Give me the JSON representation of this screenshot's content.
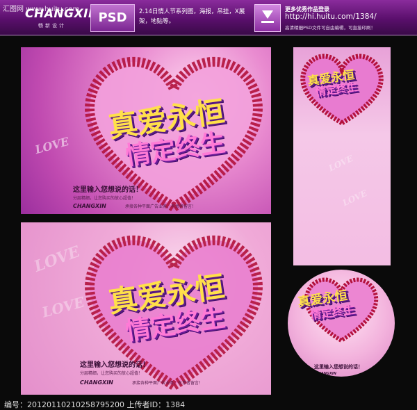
{
  "header": {
    "watermark": "汇图网 www.huitu.com",
    "logo": "CHANGXIN",
    "logo_sub": "畅新设计",
    "format": "PSD",
    "description": "2.14日情人节系列图，海报，吊挂，X展架，地贴等。",
    "more_label": "更多优秀作品登录",
    "url": "http://hi.huitu.com/1384/",
    "note": "高清精细PSD文件可自由编辑，可直接印刷！"
  },
  "poster": {
    "title_line1": "真爱永恒",
    "title_line2": "情定终生",
    "love_word": "LOVE",
    "tagline": "这里输入您想说的话！",
    "sub1": "分层精细，让您购买的放心超值！",
    "brand": "CHANGXIN",
    "brand_text": "承接各种平面广告业务，有意者留言！"
  },
  "footer": {
    "text": "编号：20120110210258795200 上传者ID：1384"
  },
  "colors": {
    "accent": "#8a2c9c",
    "title_yellow": "#ffe04a",
    "title_pink": "#ff7ad6"
  }
}
